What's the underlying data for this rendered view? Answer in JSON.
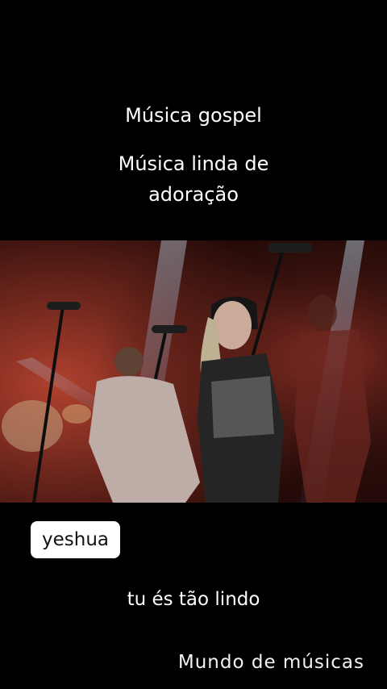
{
  "header": {
    "line1": "Música gospel",
    "line2": "Música linda de",
    "line3": "adoração"
  },
  "video": {
    "description": "Live worship band performing on stage with microphones and stage lights"
  },
  "sticker": {
    "text": "yeshua"
  },
  "lyrics": {
    "line": "tu és tão lindo"
  },
  "watermark": {
    "text": "Mundo de músicas"
  },
  "colors": {
    "background": "#000000",
    "stage_red": "#b0322a",
    "light_beam": "#9fc3e6"
  }
}
